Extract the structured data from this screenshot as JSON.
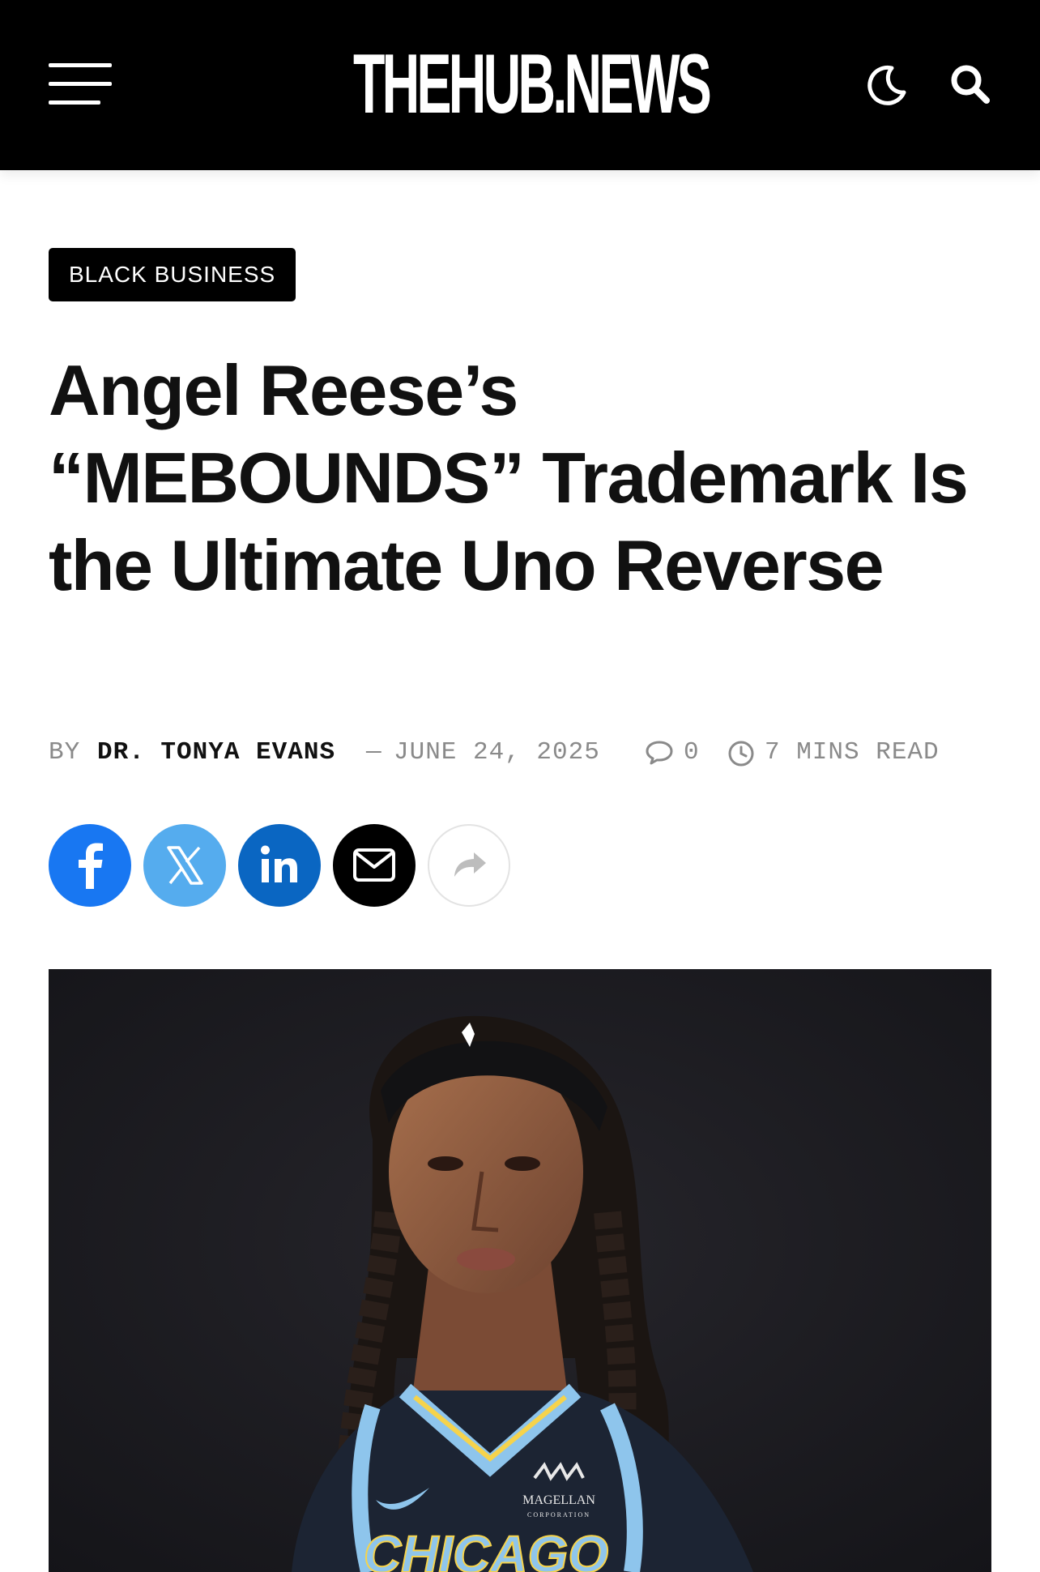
{
  "header": {
    "logo": "THEHUB.NEWS"
  },
  "article": {
    "category": "BLACK BUSINESS",
    "title": "Angel Reese’s “MEBOUNDS” Trademark Is the Ultimate Uno Reverse",
    "by_label": "BY",
    "author": "DR. TONYA EVANS",
    "date": "JUNE 24, 2025",
    "comments": "0",
    "read_time": "7 MINS READ"
  },
  "share": {
    "buttons": [
      {
        "name": "facebook",
        "color": "#1877f2"
      },
      {
        "name": "x",
        "color": "#55acee"
      },
      {
        "name": "linkedin",
        "color": "#0a66c2"
      },
      {
        "name": "email",
        "color": "#000000"
      },
      {
        "name": "more-share",
        "color": "#ffffff"
      }
    ]
  },
  "hero_image": {
    "jersey_text": "CHICAGO",
    "sponsor": "MAGELLAN",
    "sponsor_sub": "CORPORATION",
    "colors": {
      "background": "#17171b",
      "jersey": "#1c2433",
      "trim": "#8ec5ec",
      "gold": "#f6d34b"
    }
  }
}
